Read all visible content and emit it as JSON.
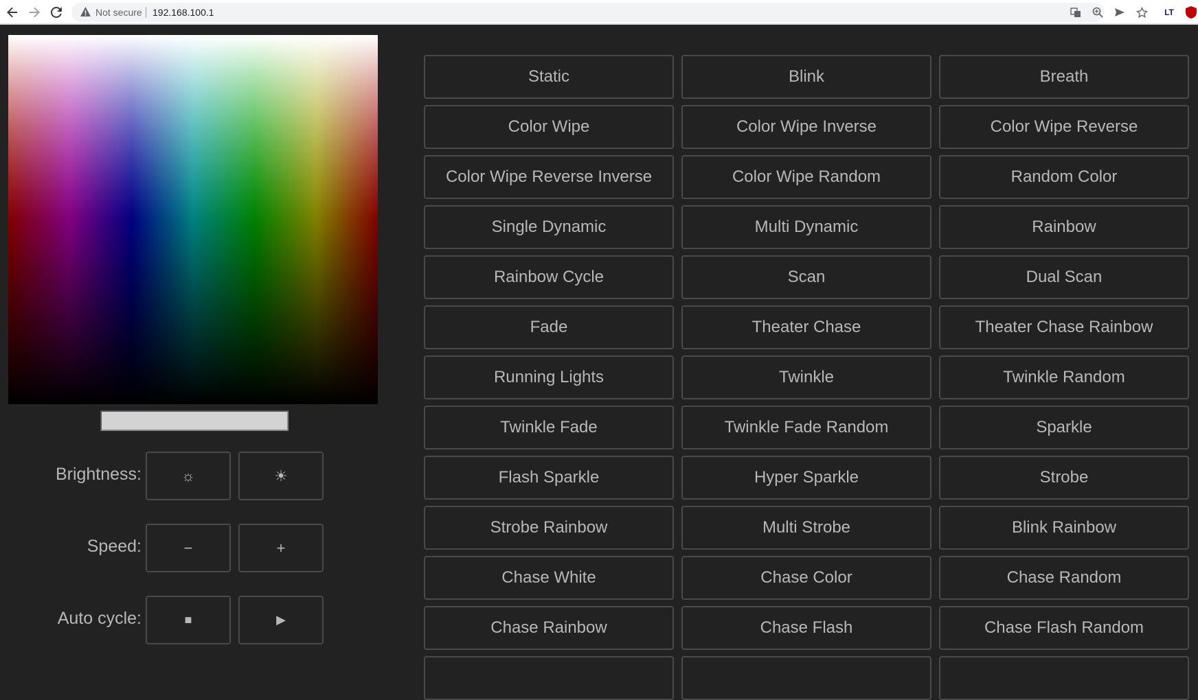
{
  "browser": {
    "security_label": "Not secure",
    "url": "192.168.100.1",
    "extension_label": "LT"
  },
  "controls": {
    "brightness": {
      "label": "Brightness:",
      "decrease_symbol": "☼",
      "increase_symbol": "☀"
    },
    "speed": {
      "label": "Speed:",
      "decrease_symbol": "−",
      "increase_symbol": "+"
    },
    "auto_cycle": {
      "label": "Auto cycle:",
      "stop_symbol": "■",
      "start_symbol": "▶"
    }
  },
  "modes": [
    "Static",
    "Blink",
    "Breath",
    "Color Wipe",
    "Color Wipe Inverse",
    "Color Wipe Reverse",
    "Color Wipe Reverse Inverse",
    "Color Wipe Random",
    "Random Color",
    "Single Dynamic",
    "Multi Dynamic",
    "Rainbow",
    "Rainbow Cycle",
    "Scan",
    "Dual Scan",
    "Fade",
    "Theater Chase",
    "Theater Chase Rainbow",
    "Running Lights",
    "Twinkle",
    "Twinkle Random",
    "Twinkle Fade",
    "Twinkle Fade Random",
    "Sparkle",
    "Flash Sparkle",
    "Hyper Sparkle",
    "Strobe",
    "Strobe Rainbow",
    "Multi Strobe",
    "Blink Rainbow",
    "Chase White",
    "Chase Color",
    "Chase Random",
    "Chase Rainbow",
    "Chase Flash",
    "Chase Flash Random"
  ],
  "colors": {
    "page_background": "#222222",
    "button_border": "#4a4a4a",
    "button_text": "#b8b8b8"
  }
}
